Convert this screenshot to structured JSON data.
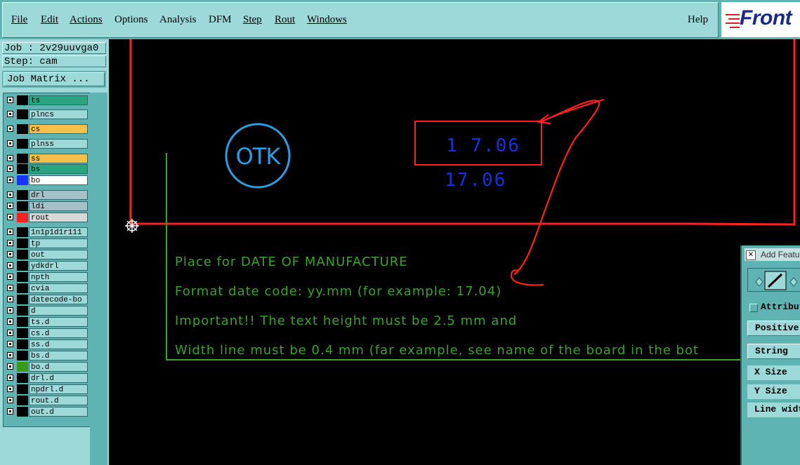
{
  "menubar": {
    "items": [
      "File",
      "Edit",
      "Actions",
      "Options",
      "Analysis",
      "DFM",
      "Step",
      "Rout",
      "Windows"
    ],
    "help_label": "Help",
    "logo_text": "Front"
  },
  "job": {
    "job_line": "Job : 2v29uuvga0",
    "step_line": "Step: cam",
    "matrix_button": "Job Matrix ..."
  },
  "layers": [
    {
      "name": "ts",
      "color": "#2aa57f",
      "swatch": "#000000"
    },
    {
      "name": "plncs",
      "color": "#9ed9d9",
      "swatch": "#000000"
    },
    {
      "name": "cs",
      "color": "#f5c04a",
      "swatch": "#000000"
    },
    {
      "name": "plnss",
      "color": "#9ed9d9",
      "swatch": "#000000"
    },
    {
      "name": "ss",
      "color": "#f5c04a",
      "swatch": "#000000"
    },
    {
      "name": "bs",
      "color": "#2aa57f",
      "swatch": "#000000"
    },
    {
      "name": "bo",
      "color": "#ffffff",
      "swatch": "#1a33ff"
    },
    {
      "name": "drl",
      "color": "#a5c0c8",
      "swatch": "#000000"
    },
    {
      "name": "ldi",
      "color": "#a5c0c8",
      "swatch": "#000000"
    },
    {
      "name": "rout",
      "color": "#d8d8d8",
      "swatch": "#ff2020"
    },
    {
      "name": "1n1p1d1r111",
      "color": "#9ed9d9",
      "swatch": "#000000"
    },
    {
      "name": "tp",
      "color": "#9ed9d9",
      "swatch": "#000000"
    },
    {
      "name": "out",
      "color": "#9ed9d9",
      "swatch": "#000000"
    },
    {
      "name": "ydkdrl",
      "color": "#9ed9d9",
      "swatch": "#000000"
    },
    {
      "name": "npth",
      "color": "#9ed9d9",
      "swatch": "#000000"
    },
    {
      "name": "cvia",
      "color": "#9ed9d9",
      "swatch": "#000000"
    },
    {
      "name": "datecode-bo",
      "color": "#9ed9d9",
      "swatch": "#000000"
    },
    {
      "name": "d",
      "color": "#9ed9d9",
      "swatch": "#000000"
    },
    {
      "name": "ts.d",
      "color": "#9ed9d9",
      "swatch": "#000000"
    },
    {
      "name": "cs.d",
      "color": "#9ed9d9",
      "swatch": "#000000"
    },
    {
      "name": "ss.d",
      "color": "#9ed9d9",
      "swatch": "#000000"
    },
    {
      "name": "bs.d",
      "color": "#9ed9d9",
      "swatch": "#000000"
    },
    {
      "name": "bo.d",
      "color": "#9ed9d9",
      "swatch": "#3a9a1a"
    },
    {
      "name": "drl.d",
      "color": "#9ed9d9",
      "swatch": "#000000"
    },
    {
      "name": "npdrl.d",
      "color": "#9ed9d9",
      "swatch": "#000000"
    },
    {
      "name": "rout.d",
      "color": "#9ed9d9",
      "swatch": "#000000"
    },
    {
      "name": "out.d",
      "color": "#9ed9d9",
      "swatch": "#000000"
    }
  ],
  "canvas": {
    "otk_label": "OTK",
    "date_code_boxed": "1 7.06",
    "date_code_plain": "17.06",
    "notes": [
      "Place for DATE OF MANUFACTURE",
      "Format date code: yy.mm (for example: 17.04)",
      "Important!! The text height must be 2.5 mm and",
      "Width line must be 0.4 mm (far example, see name of the board in the bot"
    ],
    "colors": {
      "outline": "#ff2020",
      "notes": "#3ba22a",
      "otk": "#2f9be0",
      "date_code": "#1234e0"
    }
  },
  "dialog": {
    "title": "Add Feature",
    "attributes_label": "Attributes",
    "polarity": "Positive",
    "type": "String",
    "x_size_label": "X Size",
    "y_size_label": "Y Size",
    "line_width_label": "Line width"
  }
}
